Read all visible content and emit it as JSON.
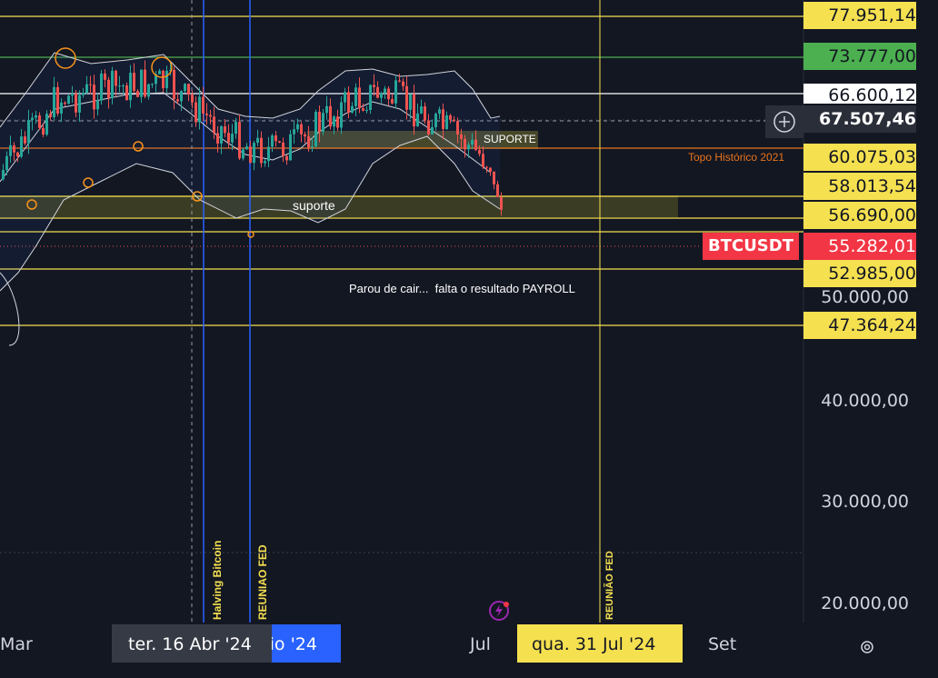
{
  "symbol": {
    "ticker": "BTCUSDT",
    "color": "#f23645"
  },
  "price_axis": {
    "labels": [
      "77.951,14",
      "73.777,00",
      "66.600,12",
      "67.507,46",
      "60.075,03",
      "58.013,54",
      "56.690,00",
      "55.282,01",
      "52.985,00",
      "50.000,00",
      "47.364,24",
      "40.000,00",
      "30.000,00",
      "20.000,00"
    ]
  },
  "time_axis": {
    "labels": [
      "Mar",
      "aio '24",
      "Jul",
      "Set"
    ],
    "crosshair_date": "ter. 16 Abr '24",
    "marker_date": "qua. 31 Jul '24"
  },
  "annotations": {
    "suporte_upper": "SUPORTE",
    "suporte_lower": "suporte",
    "topo_historico": "Topo Histórico 2021",
    "note": "Parou de cair...  falta o resultado PAYROLL",
    "halving": "Halving Bitcoin",
    "reuniao_fed_1": "REUNIAO FED",
    "reuniao_fed_2": "REUNIÃO FED"
  },
  "colors": {
    "background": "#131722",
    "yellow_line": "#f5e050",
    "green_line": "#4caf50",
    "orange_line": "#e8731c",
    "blue_line": "#2962ff",
    "candle_up": "#26a69a",
    "candle_down": "#ef5350",
    "bollinger": "#d1d4dc"
  },
  "icons": [
    "plus-circle-icon",
    "lightning-icon",
    "settings-icon"
  ]
}
